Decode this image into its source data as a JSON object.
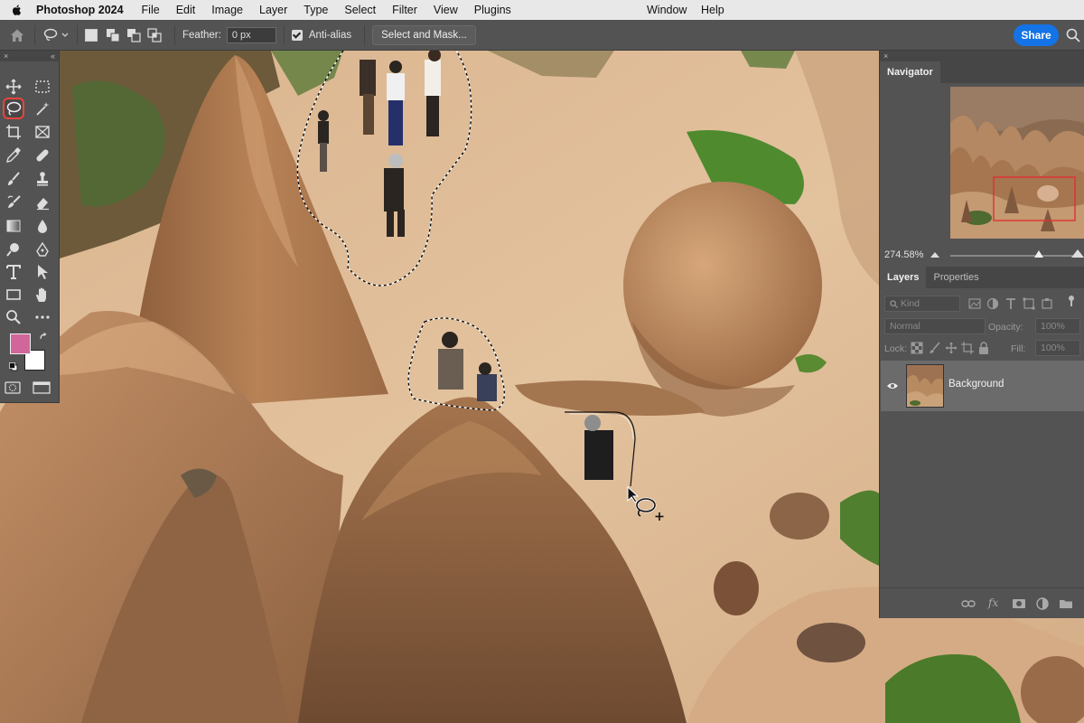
{
  "menubar": {
    "app_name": "Photoshop 2024",
    "items": [
      "File",
      "Edit",
      "Image",
      "Layer",
      "Type",
      "Select",
      "Filter",
      "View",
      "Plugins"
    ],
    "window": "Window",
    "help": "Help"
  },
  "options_bar": {
    "feather_label": "Feather:",
    "feather_value": "0 px",
    "antialias_label": "Anti-alias",
    "antialias_checked": true,
    "select_mask_label": "Select and Mask...",
    "share_label": "Share"
  },
  "tools": {
    "active_tool": "lasso-tool",
    "foreground_color": "#d0669a",
    "background_color": "#ffffff"
  },
  "navigator": {
    "tab": "Navigator",
    "zoom_label": "274.58%",
    "zoom_slider_level": 0.74
  },
  "layers_panel": {
    "tabs": [
      "Layers",
      "Properties"
    ],
    "filter_label": "Kind",
    "blend_mode": "Normal",
    "opacity_label": "Opacity:",
    "opacity_value": "100%",
    "lock_label": "Lock:",
    "fill_label": "Fill:",
    "fill_value": "100%",
    "layers": [
      {
        "name": "Background",
        "visible": true
      }
    ]
  },
  "colors": {
    "accent": "#1473e6",
    "active_tool_ring": "#e8453c",
    "navigator_frame": "#e03030"
  }
}
